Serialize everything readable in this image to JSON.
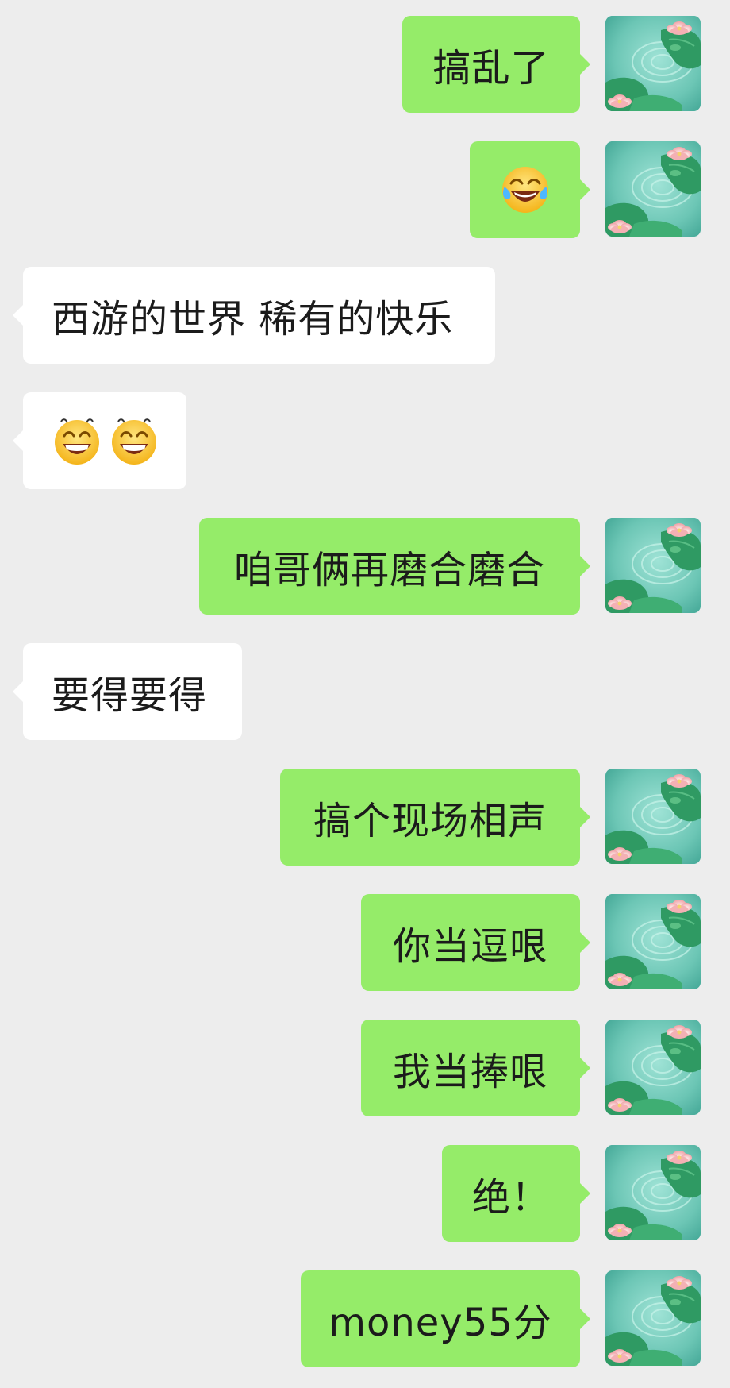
{
  "chat": {
    "messages": [
      {
        "from": "me",
        "text": "搞乱了"
      },
      {
        "from": "me",
        "emoji": "tears-of-joy-emoji"
      },
      {
        "from": "them",
        "text": "西游的世界 稀有的快乐"
      },
      {
        "from": "them",
        "emoji": "grin-emoji"
      },
      {
        "from": "me",
        "text": "咱哥俩再磨合磨合"
      },
      {
        "from": "them",
        "text": "要得要得"
      },
      {
        "from": "me",
        "text": "搞个现场相声"
      },
      {
        "from": "me",
        "text": "你当逗哏"
      },
      {
        "from": "me",
        "text": "我当捧哏"
      },
      {
        "from": "me",
        "text": "绝！"
      },
      {
        "from": "me",
        "text": "money55分"
      }
    ]
  },
  "colors": {
    "background": "#ededed",
    "my_bubble": "#95ec69",
    "their_bubble": "#ffffff",
    "text": "#1b1b1b"
  },
  "icons": {
    "avatar": "lotus-pond-avatar",
    "emoji_a": "tears-of-joy-emoji",
    "emoji_b": "grin-emoji"
  }
}
